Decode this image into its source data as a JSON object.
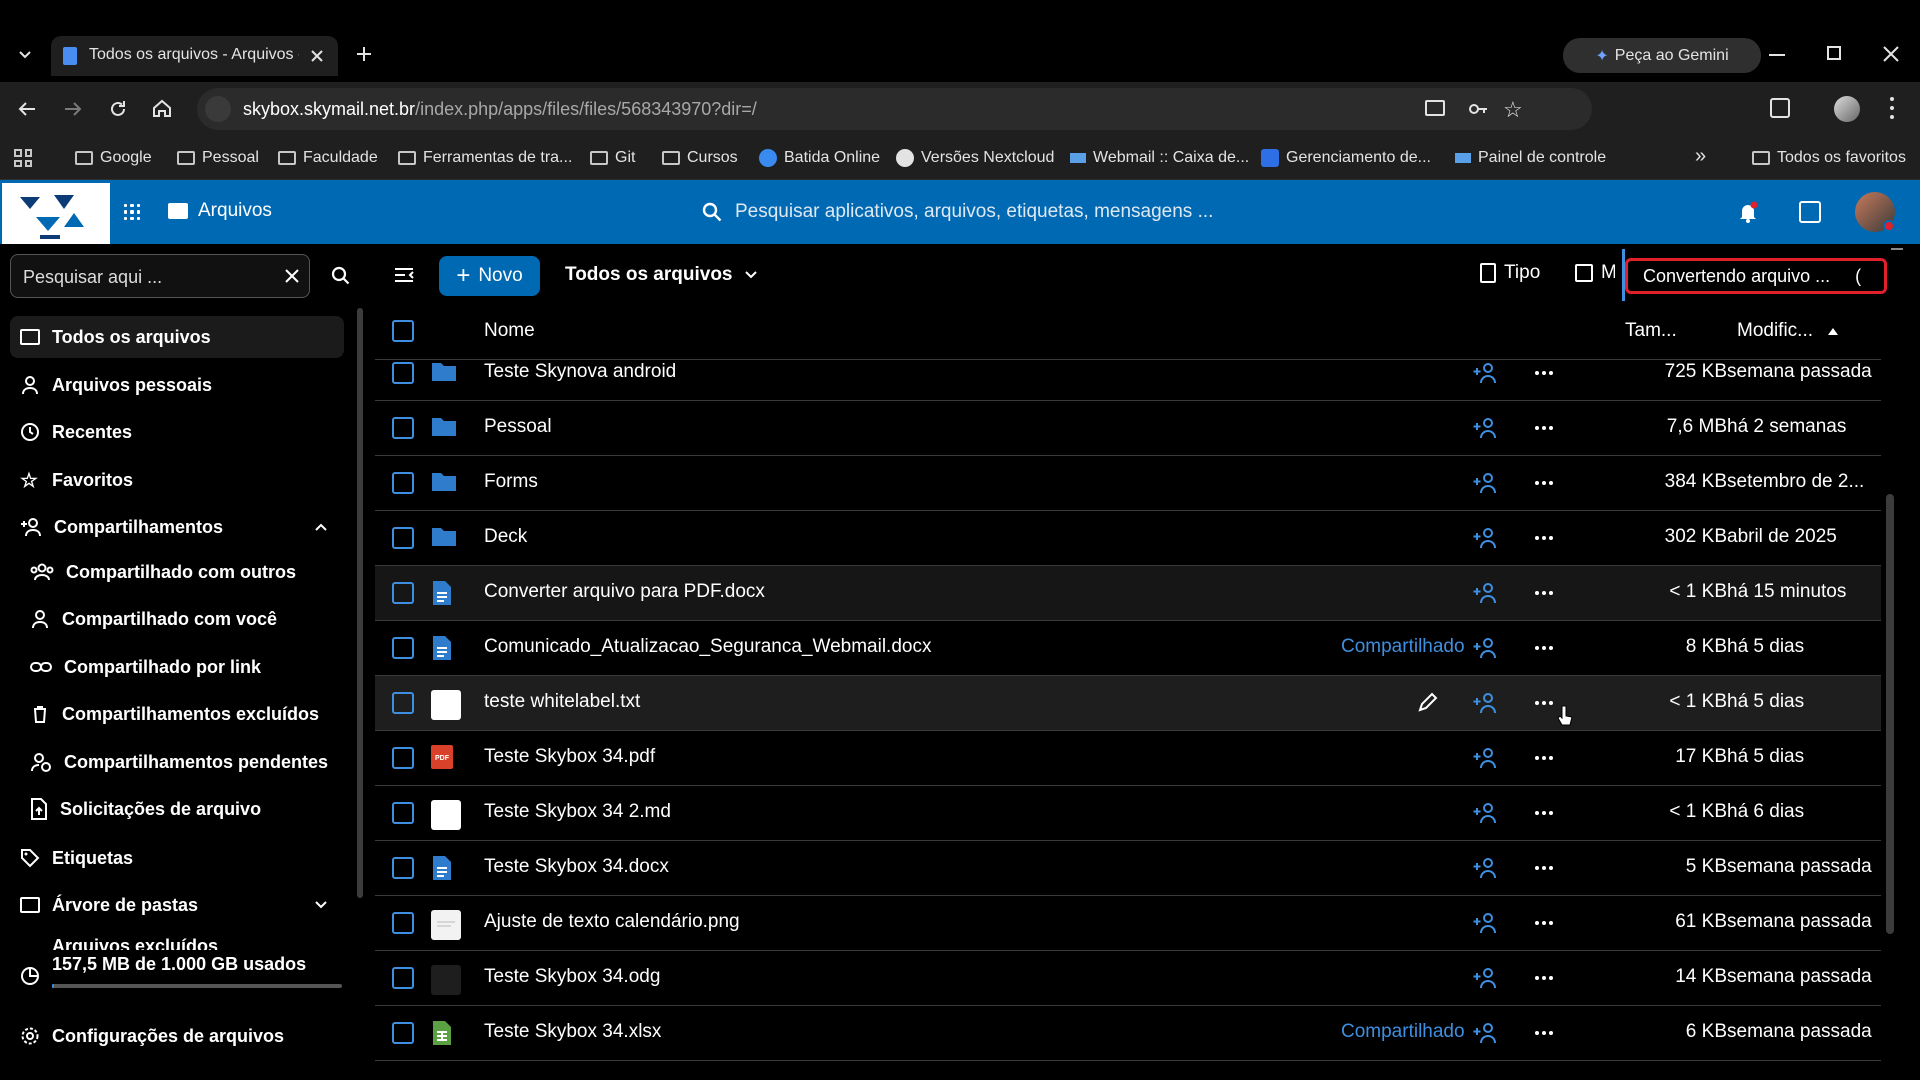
{
  "browser": {
    "tab_title": "Todos os arquivos - Arquivos - S",
    "gemini_label": "Peça ao Gemini",
    "url_host": "skybox.skymail.net.br",
    "url_path": "/index.php/apps/files/files/568343970?dir=/",
    "bookmarks": [
      {
        "label": "Google"
      },
      {
        "label": "Pessoal"
      },
      {
        "label": "Faculdade"
      },
      {
        "label": "Ferramentas de tra..."
      },
      {
        "label": "Git"
      },
      {
        "label": "Cursos"
      },
      {
        "label": "Batida Online"
      },
      {
        "label": "Versões Nextcloud"
      },
      {
        "label": "Webmail :: Caixa de..."
      },
      {
        "label": "Gerenciamento de..."
      },
      {
        "label": "Painel de controle"
      }
    ],
    "all_bookmarks": "Todos os favoritos"
  },
  "app": {
    "name": "Arquivos",
    "search_placeholder": "Pesquisar aplicativos, arquivos, etiquetas, mensagens ..."
  },
  "sidebar": {
    "filter_placeholder": "Pesquisar aqui ...",
    "items": [
      {
        "label": "Todos os arquivos"
      },
      {
        "label": "Arquivos pessoais"
      },
      {
        "label": "Recentes"
      },
      {
        "label": "Favoritos"
      },
      {
        "label": "Compartilhamentos"
      },
      {
        "label": "Compartilhado com outros"
      },
      {
        "label": "Compartilhado com você"
      },
      {
        "label": "Compartilhado por link"
      },
      {
        "label": "Compartilhamentos excluídos"
      },
      {
        "label": "Compartilhamentos pendentes"
      },
      {
        "label": "Solicitações de arquivo"
      },
      {
        "label": "Etiquetas"
      },
      {
        "label": "Árvore de pastas"
      },
      {
        "label": "Arquivos excluídos"
      }
    ],
    "quota": "157,5 MB de 1.000 GB usados",
    "quota_fraction": 0.0002,
    "settings": "Configurações de arquivos"
  },
  "toolbar": {
    "new_label": "Novo",
    "breadcrumb": "Todos os arquivos",
    "type_filter": "Tipo",
    "modified_filter": "Mo",
    "toast": "Convertendo arquivo ...     ("
  },
  "table": {
    "col_name": "Nome",
    "col_size": "Tam...",
    "col_modified": "Modific...",
    "shared_label": "Compartilhado",
    "rows": [
      {
        "name": "Teste Skynova android",
        "kind": "folder",
        "size": "725 KB",
        "modified": "semana passada"
      },
      {
        "name": "Pessoal",
        "kind": "folder",
        "size": "7,6 MB",
        "modified": "há 2 semanas"
      },
      {
        "name": "Forms",
        "kind": "folder",
        "size": "384 KB",
        "modified": "setembro de 2..."
      },
      {
        "name": "Deck",
        "kind": "folder",
        "size": "302 KB",
        "modified": "abril de 2025"
      },
      {
        "name": "Converter arquivo para PDF.docx",
        "kind": "docx",
        "size": "< 1 KB",
        "modified": "há 15 minutos"
      },
      {
        "name": "Comunicado_Atualizacao_Seguranca_Webmail.docx",
        "kind": "docx",
        "size": "8 KB",
        "modified": "há 5 dias",
        "shared": true
      },
      {
        "name": "teste whitelabel.txt",
        "kind": "txt",
        "size": "< 1 KB",
        "modified": "há 5 dias"
      },
      {
        "name": "Teste Skybox 34.pdf",
        "kind": "pdf",
        "size": "17 KB",
        "modified": "há 5 dias"
      },
      {
        "name": "Teste Skybox 34 2.md",
        "kind": "md",
        "size": "< 1 KB",
        "modified": "há 6 dias"
      },
      {
        "name": "Teste Skybox 34.docx",
        "kind": "docx",
        "size": "5 KB",
        "modified": "semana passada"
      },
      {
        "name": "Ajuste de texto calendário.png",
        "kind": "png",
        "size": "61 KB",
        "modified": "semana passada"
      },
      {
        "name": "Teste Skybox 34.odg",
        "kind": "odg",
        "size": "14 KB",
        "modified": "semana passada"
      },
      {
        "name": "Teste Skybox 34.xlsx",
        "kind": "xlsx",
        "size": "6 KB",
        "modified": "semana passada",
        "shared": true
      }
    ]
  },
  "colors": {
    "header": "#0069b4",
    "accent": "#3f8fe0",
    "toast_border": "#e0202a"
  }
}
